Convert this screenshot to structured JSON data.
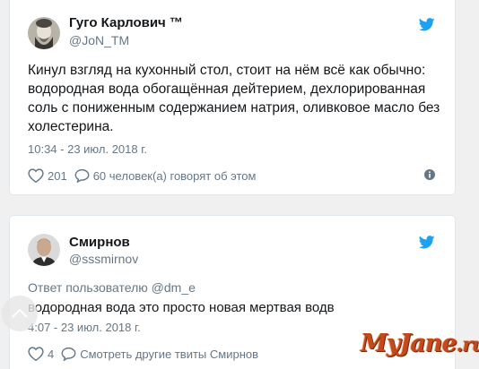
{
  "tweets": [
    {
      "author_name": "Гуго Карлович ™",
      "handle": "@JoN_TM",
      "text": "Кинул взгляд на кухонный стол, стоит на нём всё как обычно: водородная вода обогащённая дейтерием, дехлорированная соль с пониженным содержанием натрия, оливковое масло без холестерина.",
      "timestamp": "10:34 - 23 июл. 2018 г.",
      "likes": "201",
      "replies_text": "60 человек(а) говорят об этом"
    },
    {
      "author_name": "Смирнов",
      "handle": "@sssmirnov",
      "reply_prefix": "Ответ пользователю",
      "reply_mention": "@dm_e",
      "text": "водородная вода это просто новая мертвая водв",
      "timestamp": "4:07 - 23 июл. 2018 г.",
      "likes": "4",
      "more_tweets_text": "Смотреть другие твиты Смирнов"
    }
  ],
  "watermark": {
    "text": "MyJane",
    "suffix": ".ru"
  },
  "colors": {
    "twitter_blue": "#1da1f2",
    "text_primary": "#14171a",
    "text_secondary": "#657786",
    "border": "#e1e8ed",
    "watermark": "#c24a1c"
  },
  "icons": [
    "twitter-bird-icon",
    "heart-icon",
    "comment-icon",
    "info-icon",
    "chevron-up-icon"
  ]
}
